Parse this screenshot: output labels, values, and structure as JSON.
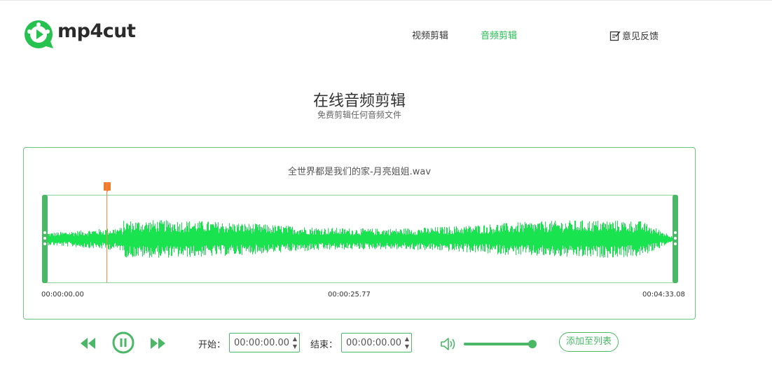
{
  "header": {
    "logo_text": "mp4cut",
    "nav": [
      {
        "label": "视频剪辑",
        "active": false
      },
      {
        "label": "音频剪辑",
        "active": true
      }
    ],
    "feedback_label": "意见反馈",
    "feedback_icon": "edit-note-icon"
  },
  "hero": {
    "title": "在线音频剪辑",
    "subtitle": "免费剪辑任何音频文件"
  },
  "editor": {
    "file_name": "全世界都是我们的家-月亮姐姐.wav",
    "timeline": {
      "start": "00:00:00.00",
      "middle": "00:00:25.77",
      "end": "00:04:33.08"
    },
    "waveform_color": "#19e34f",
    "playhead_color": "#f07b2c"
  },
  "controls": {
    "rewind_icon": "rewind-icon",
    "pause_icon": "pause-icon",
    "forward_icon": "fast-forward-icon",
    "start_label": "开始：",
    "start_value": "00:00:00.00",
    "end_label": "结束：",
    "end_value": "00:00:00.00",
    "volume_icon": "volume-icon",
    "volume_level": 1.0,
    "add_to_list_label": "添加至列表"
  },
  "colors": {
    "accent": "#4ab866",
    "accent_text": "#25bf52"
  }
}
